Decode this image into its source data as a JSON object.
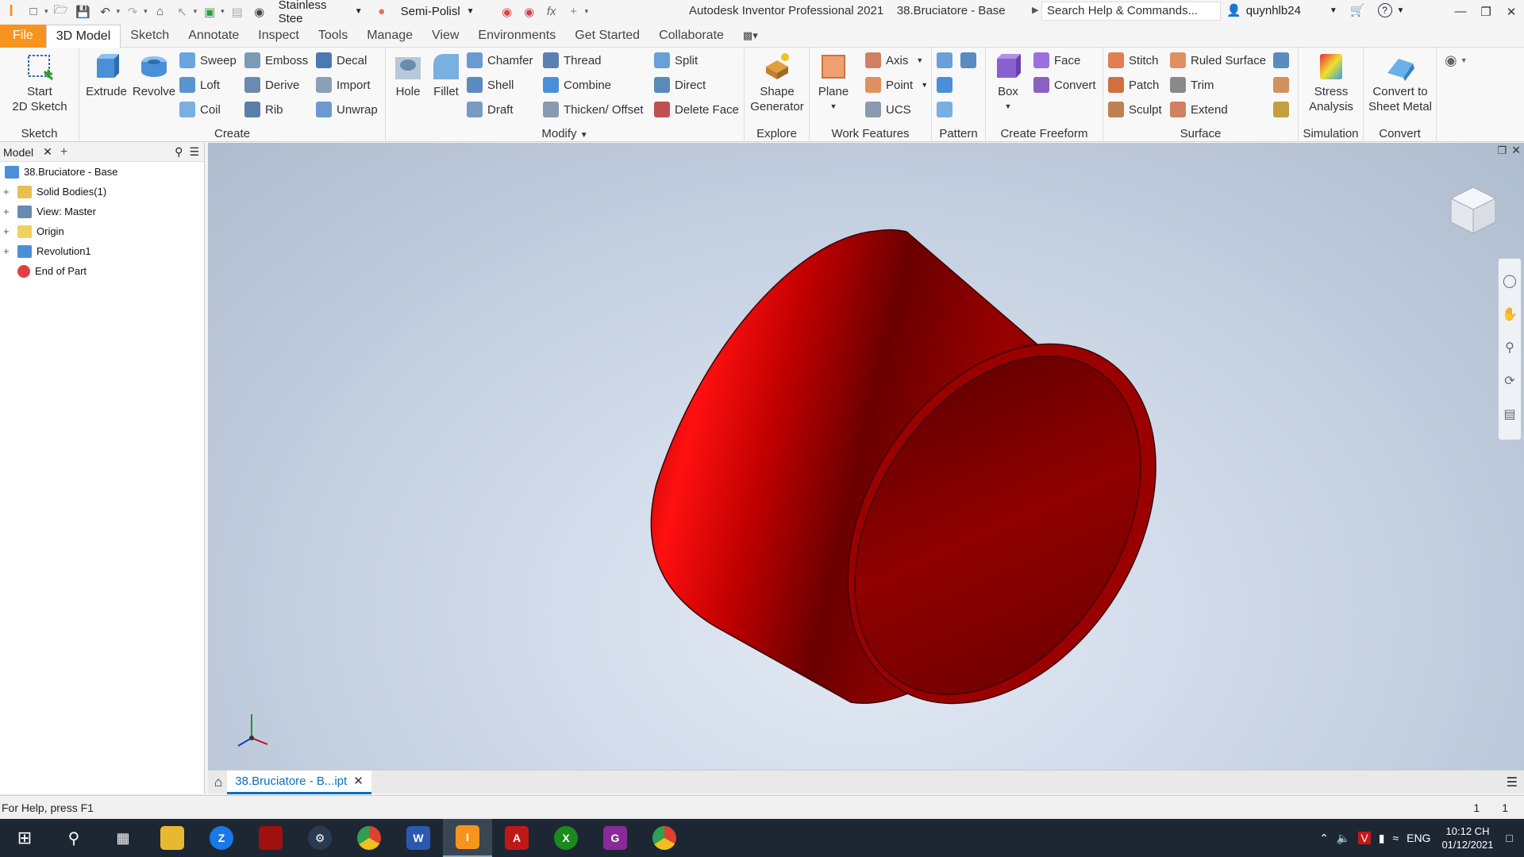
{
  "app": {
    "title": "Autodesk Inventor Professional 2021",
    "document": "38.Bruciatore - Base"
  },
  "quick_access": {
    "material": "Stainless Stee",
    "appearance": "Semi-Polisl"
  },
  "search": {
    "placeholder": "Search Help & Commands..."
  },
  "user": {
    "name": "quynhlb24"
  },
  "menu": {
    "tabs": [
      "File",
      "3D Model",
      "Sketch",
      "Annotate",
      "Inspect",
      "Tools",
      "Manage",
      "View",
      "Environments",
      "Get Started",
      "Collaborate"
    ]
  },
  "ribbon": {
    "sketch": {
      "label": "Sketch",
      "start": "Start\n2D Sketch"
    },
    "create": {
      "label": "Create",
      "extrude": "Extrude",
      "revolve": "Revolve",
      "sweep": "Sweep",
      "emboss": "Emboss",
      "decal": "Decal",
      "loft": "Loft",
      "derive": "Derive",
      "import": "Import",
      "coil": "Coil",
      "rib": "Rib",
      "unwrap": "Unwrap"
    },
    "modify": {
      "label": "Modify",
      "hole": "Hole",
      "fillet": "Fillet",
      "chamfer": "Chamfer",
      "thread": "Thread",
      "split": "Split",
      "shell": "Shell",
      "combine": "Combine",
      "direct": "Direct",
      "draft": "Draft",
      "thicken": "Thicken/ Offset",
      "delete_face": "Delete Face"
    },
    "explore": {
      "label": "Explore",
      "shape_generator": "Shape Generator"
    },
    "work_features": {
      "label": "Work Features",
      "plane": "Plane",
      "axis": "Axis",
      "point": "Point",
      "ucs": "UCS"
    },
    "pattern": {
      "label": "Pattern"
    },
    "freeform": {
      "label": "Create Freeform",
      "box": "Box",
      "face": "Face",
      "convert": "Convert"
    },
    "surface": {
      "label": "Surface",
      "stitch": "Stitch",
      "ruled": "Ruled Surface",
      "patch": "Patch",
      "trim": "Trim",
      "sculpt": "Sculpt",
      "extend": "Extend"
    },
    "simulation": {
      "label": "Simulation",
      "stress": "Stress Analysis"
    },
    "convert": {
      "label": "Convert",
      "sheet": "Convert to Sheet Metal"
    }
  },
  "browser": {
    "tab": "Model",
    "items": [
      {
        "label": "38.Bruciatore - Base"
      },
      {
        "label": "Solid Bodies(1)"
      },
      {
        "label": "View: Master"
      },
      {
        "label": "Origin"
      },
      {
        "label": "Revolution1"
      },
      {
        "label": "End of Part"
      }
    ]
  },
  "doc_tab": {
    "label": "38.Bruciatore - B...ipt"
  },
  "status": {
    "help": "For Help, press F1",
    "count_a": "1",
    "count_b": "1"
  },
  "taskbar": {
    "lang": "ENG",
    "time": "10:12 CH",
    "date": "01/12/2021"
  },
  "colors": {
    "accent": "#f7941d",
    "part": "#b30000",
    "taskbar": "#1d2733"
  }
}
